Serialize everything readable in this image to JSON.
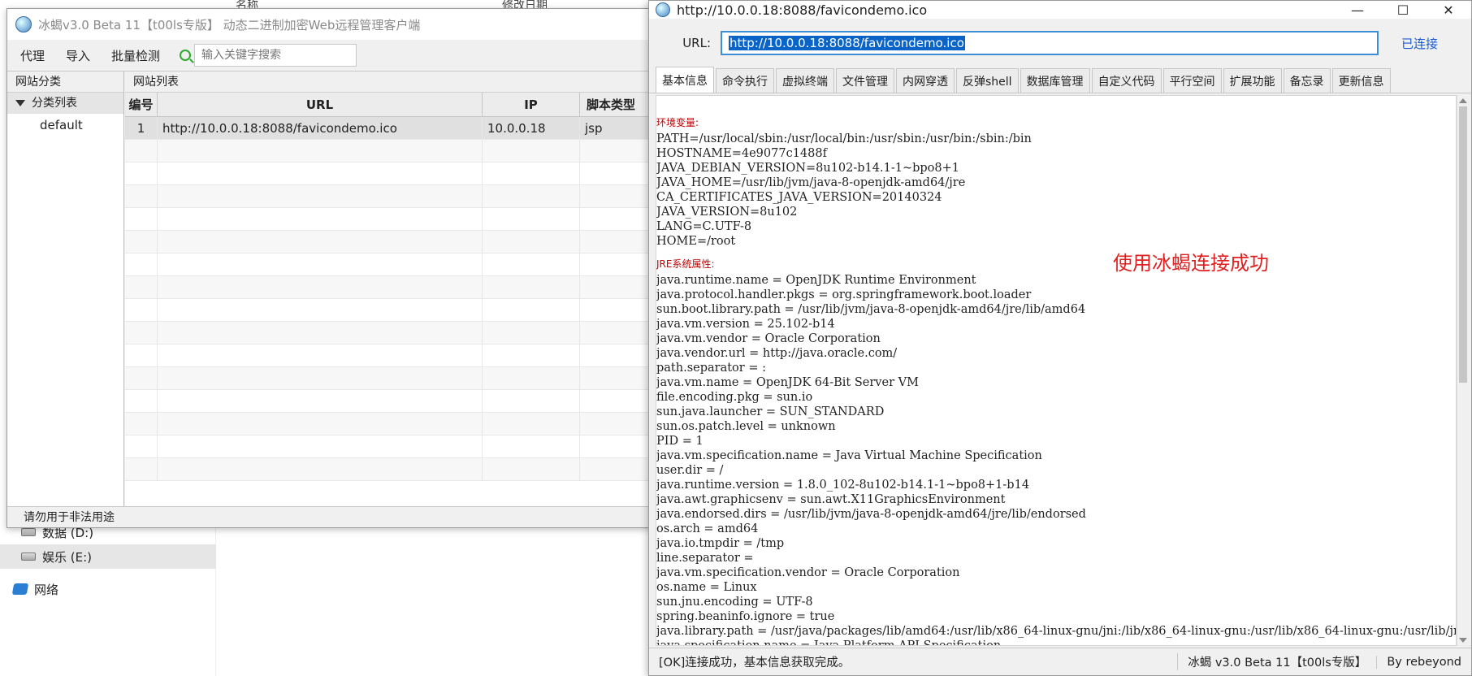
{
  "explorer": {
    "col_name": "名称",
    "col_modified": "修改日期",
    "drives": [
      {
        "label": "数据 (D:)"
      },
      {
        "label": "娱乐 (E:)"
      }
    ],
    "network": "网络"
  },
  "main_window": {
    "title": "冰蝎v3.0 Beta 11【t00ls专版】 动态二进制加密Web远程管理客户端",
    "toolbar": {
      "proxy": "代理",
      "import": "导入",
      "batch_check": "批量检测",
      "search_placeholder": "输入关键字搜索"
    },
    "left_pane": {
      "header": "网站分类",
      "tree_root": "分类列表",
      "tree_child": "default"
    },
    "right_pane": {
      "header": "网站列表",
      "columns": {
        "no": "编号",
        "url": "URL",
        "ip": "IP",
        "type": "脚本类型"
      },
      "rows": [
        {
          "no": "1",
          "url": "http://10.0.0.18:8088/favicondemo.ico",
          "ip": "10.0.0.18",
          "type": "jsp"
        }
      ]
    },
    "status": "请勿用于非法用途"
  },
  "shell_window": {
    "title": "http://10.0.0.18:8088/favicondemo.ico",
    "controls": {
      "minimize": "—",
      "maximize": "☐",
      "close": "✕"
    },
    "url_label": "URL:",
    "url_value": "http://10.0.0.18:8088/favicondemo.ico",
    "connection_status": "已连接",
    "tabs": [
      "基本信息",
      "命令执行",
      "虚拟终端",
      "文件管理",
      "内网穿透",
      "反弹shell",
      "数据库管理",
      "自定义代码",
      "平行空间",
      "扩展功能",
      "备忘录",
      "更新信息"
    ],
    "active_tab": 0,
    "env_title": "环境变量:",
    "env_lines": [
      "PATH=/usr/local/sbin:/usr/local/bin:/usr/sbin:/usr/bin:/sbin:/bin",
      "HOSTNAME=4e9077c1488f",
      "JAVA_DEBIAN_VERSION=8u102-b14.1-1~bpo8+1",
      "JAVA_HOME=/usr/lib/jvm/java-8-openjdk-amd64/jre",
      "CA_CERTIFICATES_JAVA_VERSION=20140324",
      "JAVA_VERSION=8u102",
      "LANG=C.UTF-8",
      "HOME=/root"
    ],
    "jre_title": "JRE系统属性:",
    "jre_lines": [
      "java.runtime.name = OpenJDK Runtime Environment",
      "java.protocol.handler.pkgs = org.springframework.boot.loader",
      "sun.boot.library.path = /usr/lib/jvm/java-8-openjdk-amd64/jre/lib/amd64",
      "java.vm.version = 25.102-b14",
      "java.vm.vendor = Oracle Corporation",
      "java.vendor.url = http://java.oracle.com/",
      "path.separator = :",
      "java.vm.name = OpenJDK 64-Bit Server VM",
      "file.encoding.pkg = sun.io",
      "sun.java.launcher = SUN_STANDARD",
      "sun.os.patch.level = unknown",
      "PID = 1",
      "java.vm.specification.name = Java Virtual Machine Specification",
      "user.dir = /",
      "java.runtime.version = 1.8.0_102-8u102-b14.1-1~bpo8+1-b14",
      "java.awt.graphicsenv = sun.awt.X11GraphicsEnvironment",
      "java.endorsed.dirs = /usr/lib/jvm/java-8-openjdk-amd64/jre/lib/endorsed",
      "os.arch = amd64",
      "java.io.tmpdir = /tmp",
      "line.separator =",
      "java.vm.specification.vendor = Oracle Corporation",
      "os.name = Linux",
      "sun.jnu.encoding = UTF-8",
      "spring.beaninfo.ignore = true",
      "java.library.path = /usr/java/packages/lib/amd64:/usr/lib/x86_64-linux-gnu/jni:/lib/x86_64-linux-gnu:/usr/lib/x86_64-linux-gnu:/usr/lib/jni:/lib:/usr/lib",
      "java.specification.name = Java Platform API Specification"
    ],
    "annotation": "使用冰蝎连接成功",
    "status_left": "[OK]连接成功，基本信息获取完成。",
    "status_mid": "冰蝎 v3.0 Beta 11【t00ls专版】",
    "status_right": "By rebeyond"
  }
}
